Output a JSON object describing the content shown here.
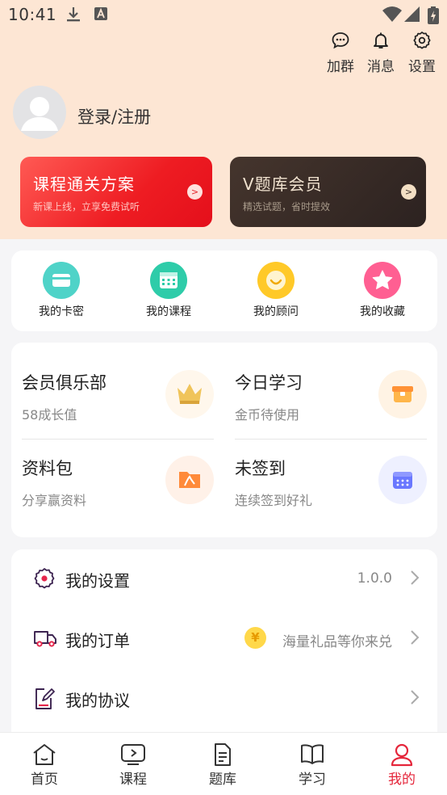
{
  "status_bar": {
    "time": "10:41"
  },
  "header": {
    "actions": [
      {
        "label": "加群",
        "icon": "chat-bubble-icon"
      },
      {
        "label": "消息",
        "icon": "bell-icon"
      },
      {
        "label": "设置",
        "icon": "gear-icon"
      }
    ]
  },
  "profile": {
    "login_text": "登录/注册"
  },
  "banners": [
    {
      "title": "课程通关方案",
      "subtitle": "新课上线，立享免费试听",
      "arrow": ">"
    },
    {
      "title": "V题库会员",
      "subtitle": "精选试题，省时提效",
      "arrow": ">"
    }
  ],
  "quick_links": [
    {
      "label": "我的卡密",
      "icon": "card-icon"
    },
    {
      "label": "我的课程",
      "icon": "calendar-icon"
    },
    {
      "label": "我的顾问",
      "icon": "advisor-icon"
    },
    {
      "label": "我的收藏",
      "icon": "star-icon"
    }
  ],
  "club": [
    {
      "title": "会员俱乐部",
      "subtitle": "58成长值",
      "icon": "crown-icon"
    },
    {
      "title": "今日学习",
      "subtitle": "金币待使用",
      "icon": "gift-box-icon"
    },
    {
      "title": "资料包",
      "subtitle": "分享赢资料",
      "icon": "pdf-folder-icon"
    },
    {
      "title": "未签到",
      "subtitle": "连续签到好礼",
      "icon": "sign-in-calendar-icon"
    }
  ],
  "menu": [
    {
      "label": "我的设置",
      "value": "1.0.0",
      "icon": "settings-gear-icon"
    },
    {
      "label": "我的订单",
      "value": "海量礼品等你来兑",
      "badge": "¥",
      "icon": "truck-icon"
    },
    {
      "label": "我的协议",
      "value": "",
      "icon": "edit-document-icon"
    }
  ],
  "tabs": [
    {
      "label": "首页",
      "icon": "home-icon"
    },
    {
      "label": "课程",
      "icon": "play-icon"
    },
    {
      "label": "题库",
      "icon": "question-bank-icon"
    },
    {
      "label": "学习",
      "icon": "book-icon"
    },
    {
      "label": "我的",
      "icon": "user-icon",
      "active": true
    }
  ],
  "colors": {
    "accent": "#e5263b",
    "header_bg": "#fde6d4",
    "page_bg": "#f5f5f7"
  }
}
